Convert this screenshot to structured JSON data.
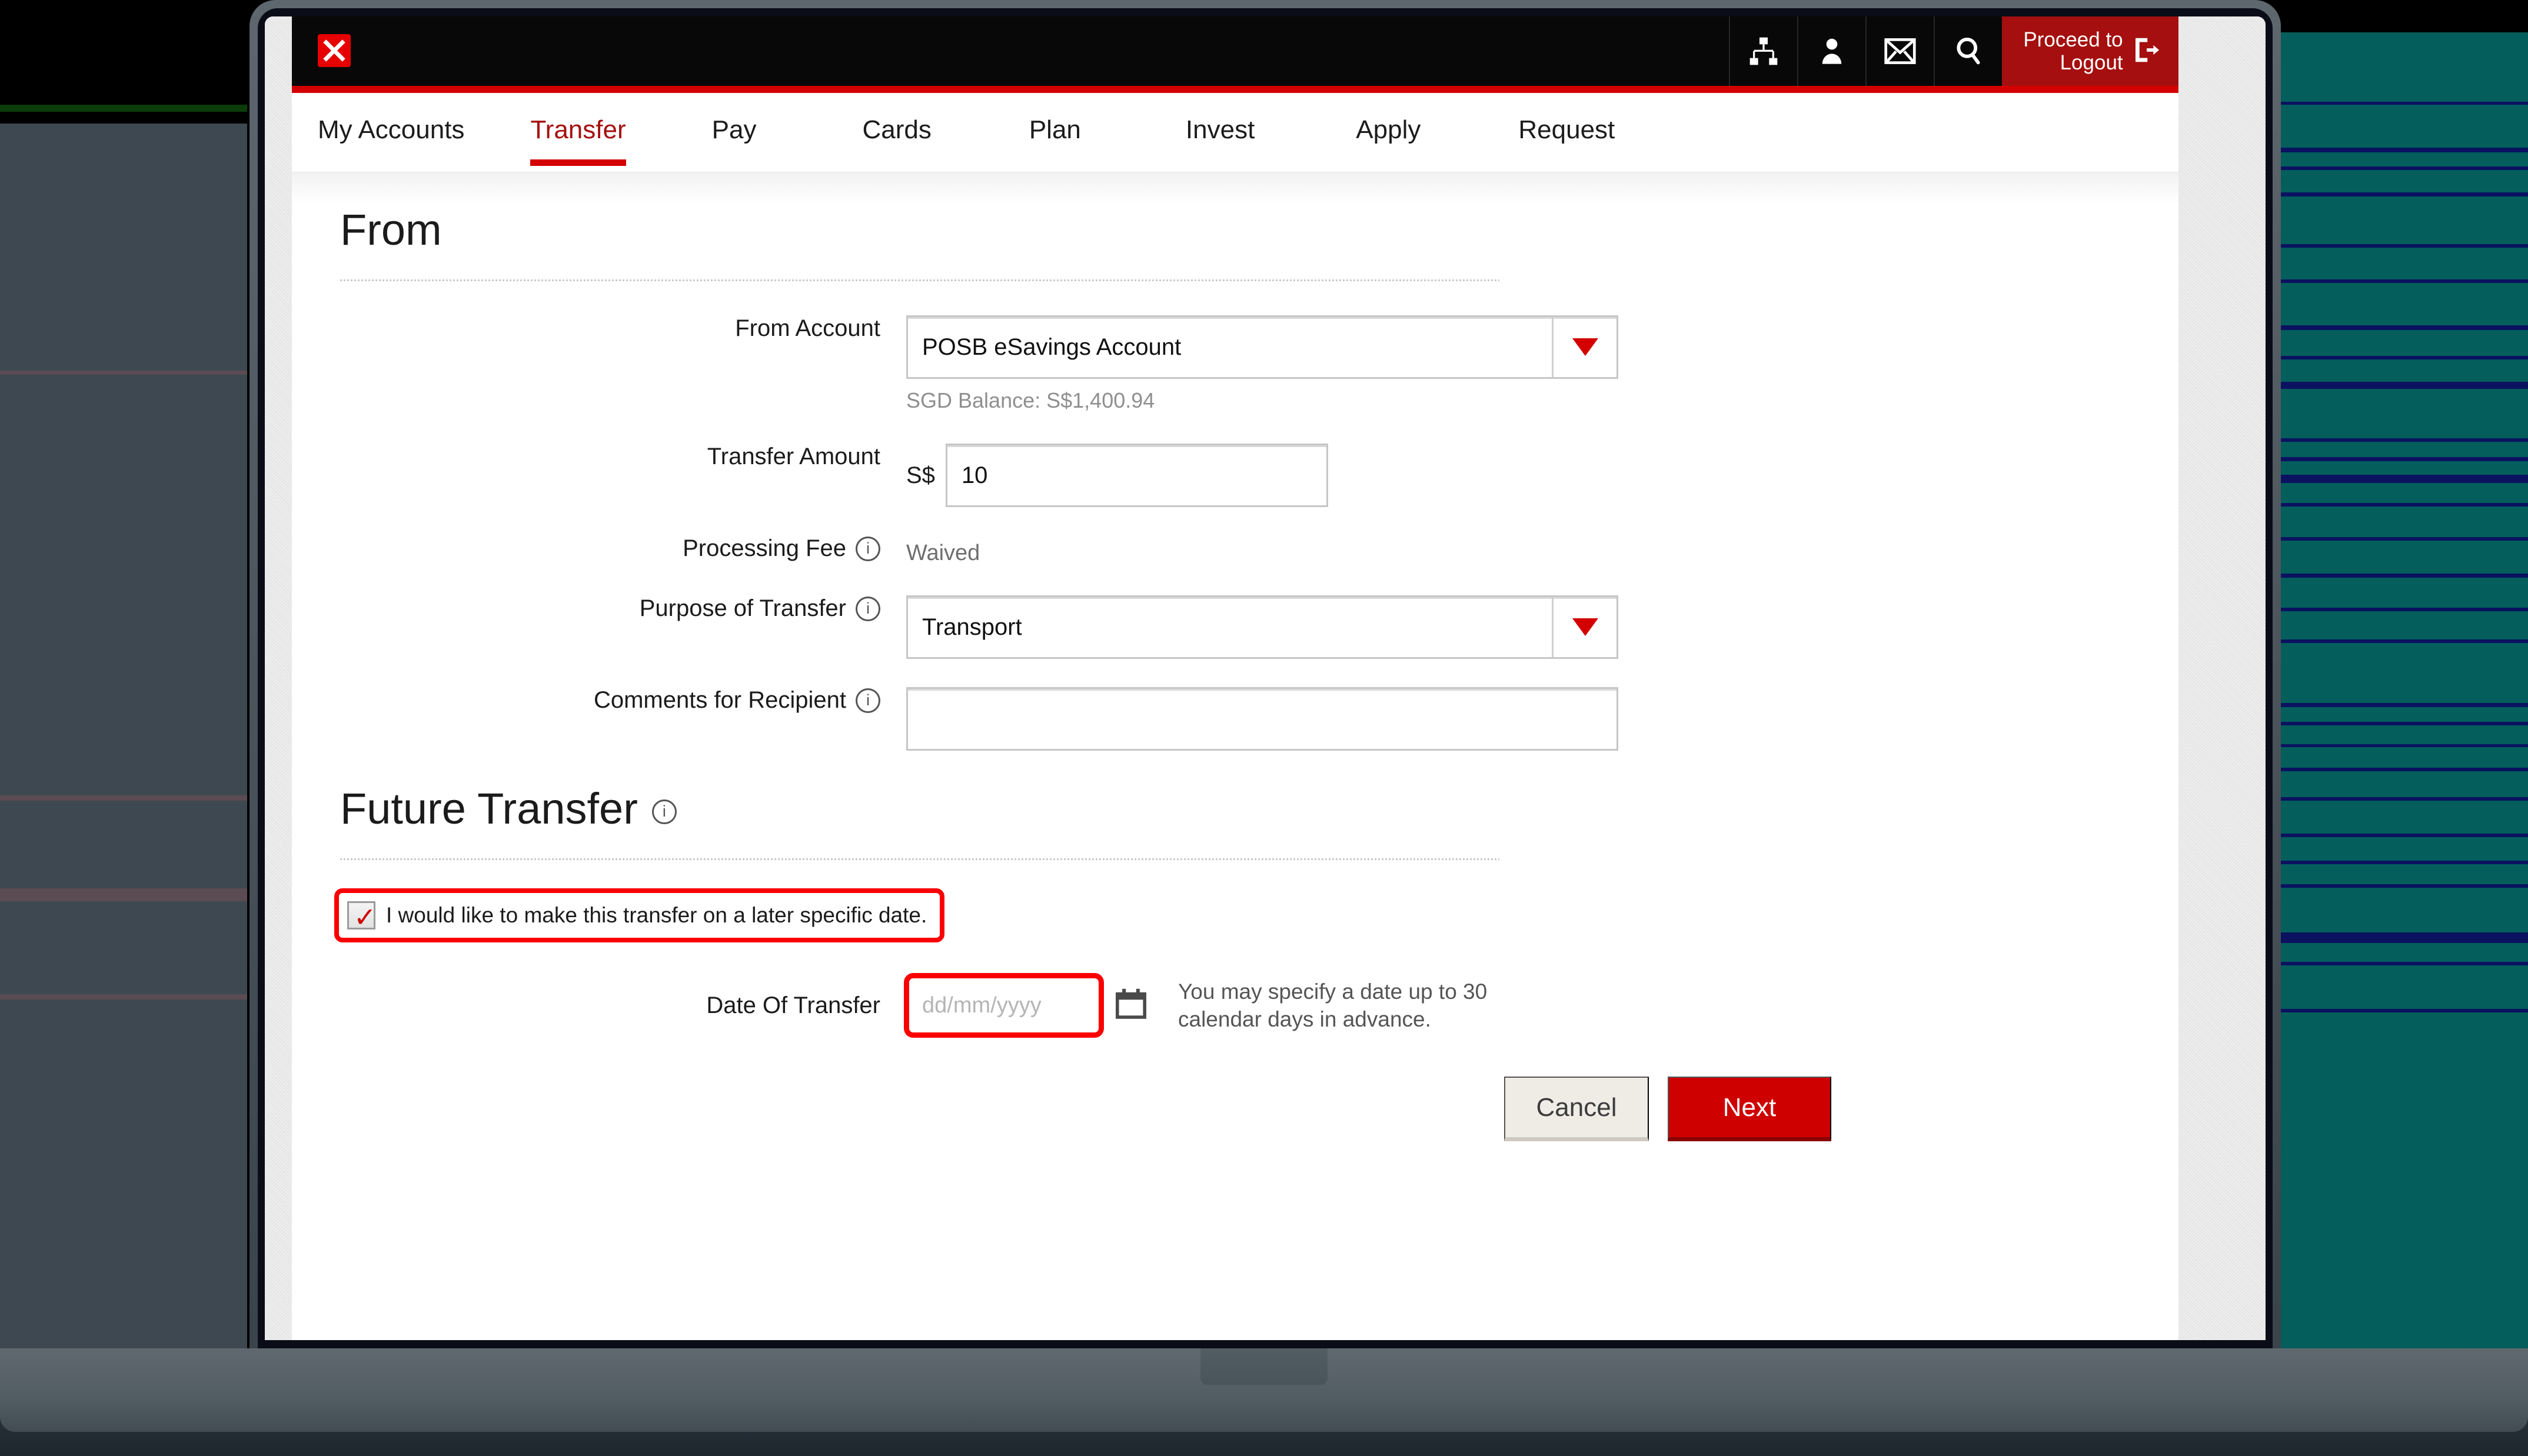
{
  "window": {
    "device": "laptop"
  },
  "topbar": {
    "logo_icon": "x-logo-icon",
    "icons": [
      {
        "name": "sitemap-icon",
        "label": "Sitemap"
      },
      {
        "name": "user-icon",
        "label": "Profile"
      },
      {
        "name": "mail-icon",
        "label": "Messages"
      },
      {
        "name": "search-icon",
        "label": "Search"
      }
    ],
    "logout_label": "Proceed to\nLogout",
    "logout_icon": "logout-arrow-icon"
  },
  "nav": {
    "tabs": [
      {
        "label": "My Accounts",
        "active": false
      },
      {
        "label": "Transfer",
        "active": true
      },
      {
        "label": "Pay",
        "active": false
      },
      {
        "label": "Cards",
        "active": false
      },
      {
        "label": "Plan",
        "active": false
      },
      {
        "label": "Invest",
        "active": false
      },
      {
        "label": "Apply",
        "active": false
      },
      {
        "label": "Request",
        "active": false
      }
    ]
  },
  "from_section": {
    "title": "From",
    "from_account": {
      "label": "From Account",
      "value": "POSB eSavings Account",
      "balance": "SGD Balance: S$1,400.94"
    },
    "transfer_amount": {
      "label": "Transfer Amount",
      "currency": "S$",
      "value": "10"
    },
    "processing_fee": {
      "label": "Processing Fee",
      "value": "Waived"
    },
    "purpose": {
      "label": "Purpose of Transfer",
      "value": "Transport"
    },
    "comments": {
      "label": "Comments for Recipient",
      "value": ""
    }
  },
  "future_transfer": {
    "title": "Future Transfer",
    "checkbox_label": "I would like to make this transfer on a later specific date.",
    "checkbox_checked": true,
    "date_label": "Date Of Transfer",
    "date_placeholder": "dd/mm/yyyy",
    "date_value": "",
    "hint": "You may specify a date up to 30\ncalendar days in advance."
  },
  "actions": {
    "cancel_label": "Cancel",
    "next_label": "Next"
  },
  "colors": {
    "brand_red": "#d40000",
    "dark_red": "#a50f0f",
    "highlight_red": "#fa0000",
    "topbar_black": "#080808",
    "teal_backdrop": "#035e5c",
    "slate_backdrop": "#3e4850"
  }
}
